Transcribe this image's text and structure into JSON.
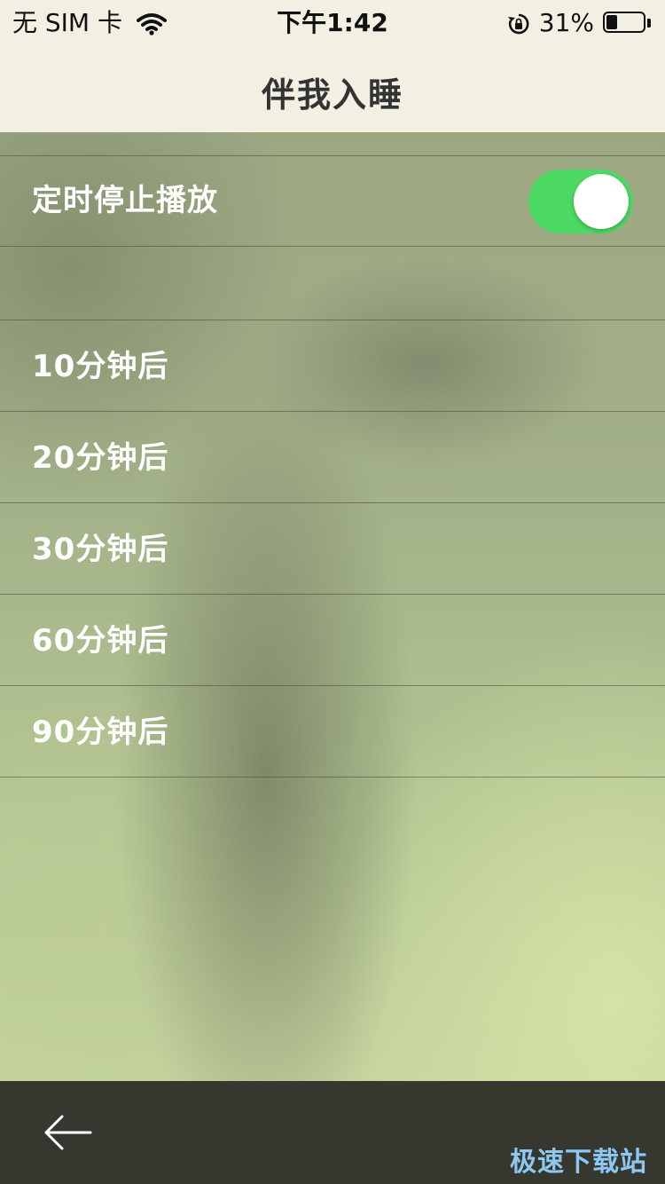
{
  "status_bar": {
    "carrier": "无 SIM 卡",
    "time": "下午1:42",
    "battery_percent": "31%",
    "battery_level": 0.31
  },
  "header": {
    "title": "伴我入睡"
  },
  "settings": {
    "timer_label": "定时停止播放",
    "timer_enabled": true,
    "toggle_color": "#4cd964",
    "options": [
      {
        "label": "10分钟后"
      },
      {
        "label": "20分钟后"
      },
      {
        "label": "30分钟后"
      },
      {
        "label": "60分钟后"
      },
      {
        "label": "90分钟后"
      }
    ]
  },
  "footer": {
    "back_icon": "arrow-left-icon",
    "watermark": "极速下载站"
  }
}
